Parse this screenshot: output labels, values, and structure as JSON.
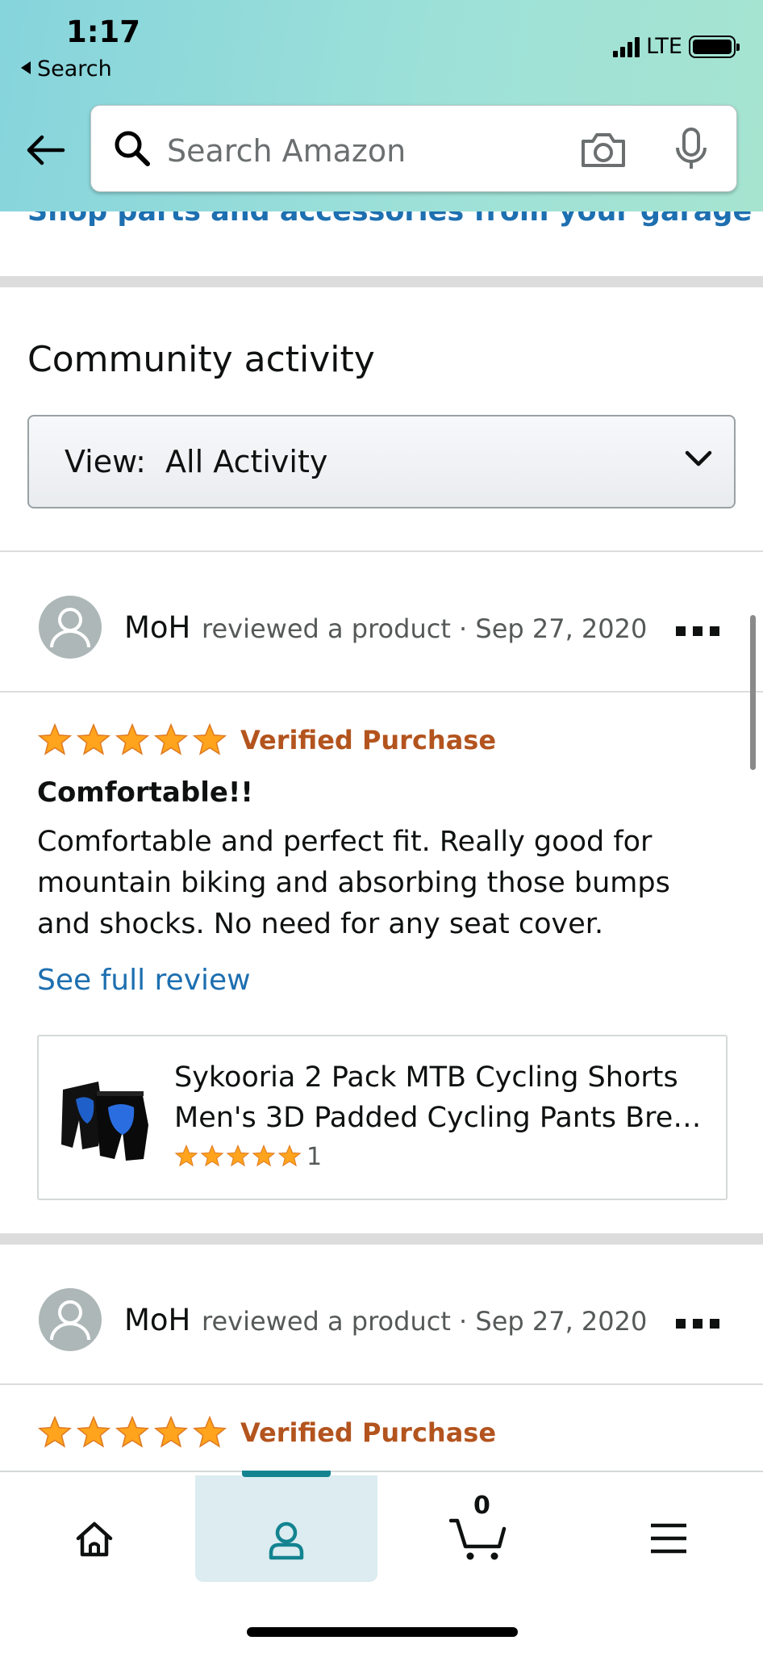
{
  "status_bar": {
    "time": "1:17",
    "back_app": "Search",
    "network": "LTE"
  },
  "search": {
    "placeholder": "Search Amazon"
  },
  "garage_link": "Shop parts and accessories from your garage",
  "community": {
    "title": "Community activity",
    "view_label": "View:  All Activity"
  },
  "activities": [
    {
      "user": "MoH",
      "meta": "reviewed a product · Sep 27, 2020",
      "rating": 5,
      "verified": "Verified Purchase",
      "review_title": "Comfortable!!",
      "review_body": "Comfortable and perfect fit. Really good for mountain biking and absorbing those bumps and shocks. No need for any seat cover.",
      "see_full": "See full review",
      "product": {
        "title_line1": "Sykooria 2 Pack MTB Cycling Shorts",
        "title_line2": "Men's 3D Padded Cycling Pants Brea...",
        "rating": 5,
        "rating_count": "1"
      }
    },
    {
      "user": "MoH",
      "meta": "reviewed a product · Sep 27, 2020",
      "rating": 5,
      "verified": "Verified Purchase"
    }
  ],
  "bottom_nav": {
    "items": [
      "home-icon",
      "account-icon",
      "cart-icon",
      "menu-icon"
    ],
    "cart_count": "0",
    "active": "account-icon"
  },
  "colors": {
    "link": "#1d6fb0",
    "verified": "#b3541e",
    "star": "#ffa41c",
    "accent": "#138390"
  }
}
